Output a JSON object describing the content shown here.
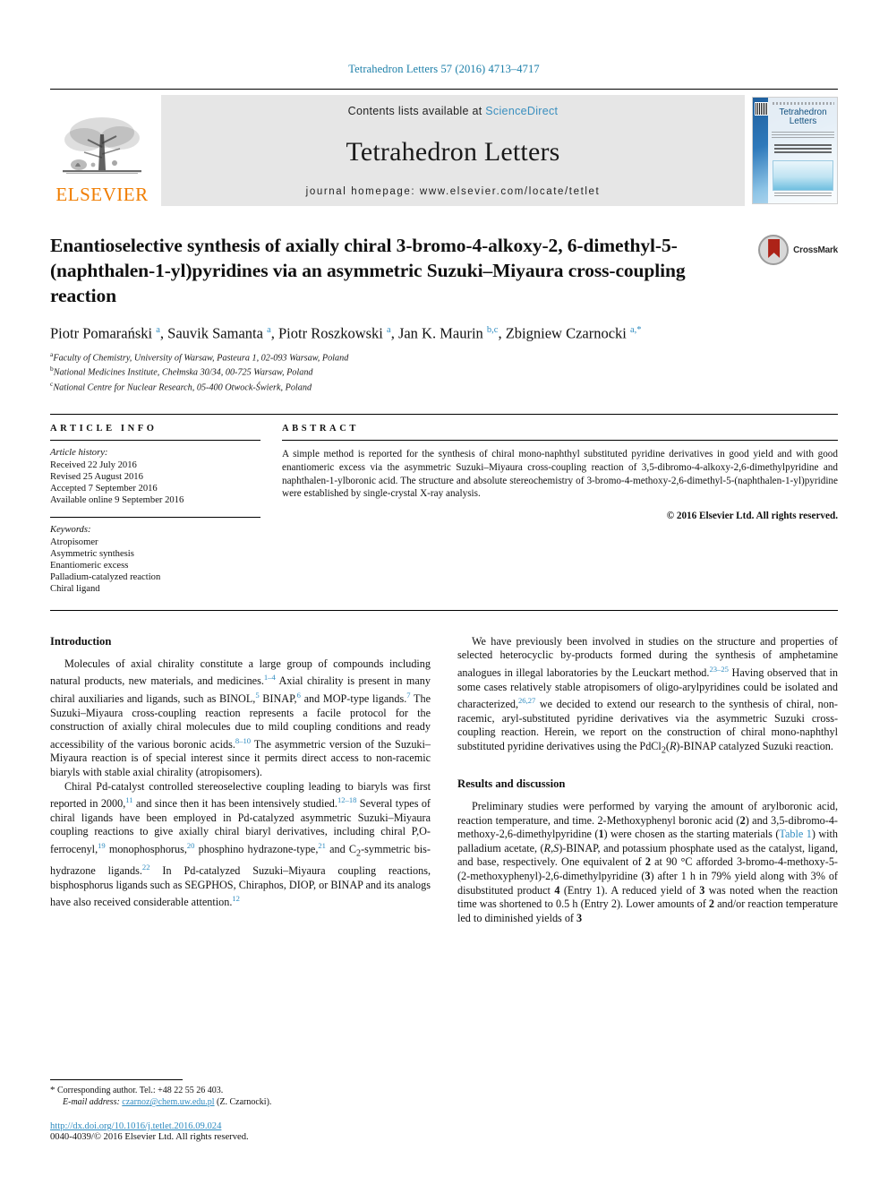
{
  "running_head": "Tetrahedron Letters 57 (2016) 4713–4717",
  "masthead": {
    "contents_prefix": "Contents lists available at ",
    "sciencedirect": "ScienceDirect",
    "journal_title": "Tetrahedron Letters",
    "homepage": "journal homepage: www.elsevier.com/locate/tetlet",
    "publisher_word": "ELSEVIER",
    "cover_title_line1": "Tetrahedron",
    "cover_title_line2": "Letters"
  },
  "article": {
    "title": "Enantioselective synthesis of axially chiral 3-bromo-4-alkoxy-2, 6-dimethyl-5-(naphthalen-1-yl)pyridines via an asymmetric Suzuki–Miyaura cross-coupling reaction",
    "crossmark_label": "CrossMark",
    "authors_html": "Piotr Pomarański <sup>a</sup>, Sauvik Samanta <sup>a</sup>, Piotr Roszkowski <sup>a</sup>, Jan K. Maurin <sup>b,c</sup>, Zbigniew Czarnocki <sup>a,*</sup>",
    "affiliations": [
      "Faculty of Chemistry, University of Warsaw, Pasteura 1, 02-093 Warsaw, Poland",
      "National Medicines Institute, Chełmska 30/34, 00-725 Warsaw, Poland",
      "National Centre for Nuclear Research, 05-400 Otwock-Świerk, Poland"
    ],
    "affiliation_marks": [
      "a",
      "b",
      "c"
    ]
  },
  "article_info": {
    "heading": "ARTICLE INFO",
    "history_heading": "Article history:",
    "history": [
      "Received 22 July 2016",
      "Revised 25 August 2016",
      "Accepted 7 September 2016",
      "Available online 9 September 2016"
    ],
    "keywords_heading": "Keywords:",
    "keywords": [
      "Atropisomer",
      "Asymmetric synthesis",
      "Enantiomeric excess",
      "Palladium-catalyzed reaction",
      "Chiral ligand"
    ]
  },
  "abstract": {
    "heading": "ABSTRACT",
    "text": "A simple method is reported for the synthesis of chiral mono-naphthyl substituted pyridine derivatives in good yield and with good enantiomeric excess via the asymmetric Suzuki–Miyaura cross-coupling reaction of 3,5-dibromo-4-alkoxy-2,6-dimethylpyridine and naphthalen-1-ylboronic acid. The structure and absolute stereochemistry of 3-bromo-4-methoxy-2,6-dimethyl-5-(naphthalen-1-yl)pyridine were established by single-crystal X-ray analysis.",
    "copyright": "© 2016 Elsevier Ltd. All rights reserved."
  },
  "body": {
    "introduction_heading": "Introduction",
    "results_heading": "Results and discussion",
    "intro_p1_html": "Molecules of axial chirality constitute a large group of compounds including natural products, new materials, and medicines.<span class=\"ref\">1–4</span> Axial chirality is present in many chiral auxiliaries and ligands, such as BINOL,<span class=\"ref\">5</span> BINAP,<span class=\"ref\">6</span> and MOP-type ligands.<span class=\"ref\">7</span> The Suzuki–Miyaura cross-coupling reaction represents a facile protocol for the construction of axially chiral molecules due to mild coupling conditions and ready accessibility of the various boronic acids.<span class=\"ref\">8–10</span> The asymmetric version of the Suzuki–Miyaura reaction is of special interest since it permits direct access to non-racemic biaryls with stable axial chirality (atropisomers).",
    "intro_p2_html": "Chiral Pd-catalyst controlled stereoselective coupling leading to biaryls was first reported in 2000,<span class=\"ref\">11</span> and since then it has been intensively studied.<span class=\"ref\">12–18</span> Several types of chiral ligands have been employed in Pd-catalyzed asymmetric Suzuki–Miyaura coupling reactions to give axially chiral biaryl derivatives, including chiral P,O-ferrocenyl,<span class=\"ref\">19</span> monophosphorus,<span class=\"ref\">20</span> phosphino hydrazone-type,<span class=\"ref\">21</span> and C<sub>2</sub>-symmetric bis-hydrazone ligands.<span class=\"ref\">22</span> In Pd-catalyzed Suzuki–Miyaura coupling reactions, bisphosphorus ligands such as SEGPHOS, Chiraphos, DIOP, or BINAP and its analogs have also received considerable attention.<span class=\"ref\">12</span>",
    "right_p1_html": "We have previously been involved in studies on the structure and properties of selected heterocyclic by-products formed during the synthesis of amphetamine analogues in illegal laboratories by the Leuckart method.<span class=\"ref\">23–25</span> Having observed that in some cases relatively stable atropisomers of oligo-arylpyridines could be isolated and characterized,<span class=\"ref\">26,27</span> we decided to extend our research to the synthesis of chiral, non-racemic, aryl-substituted pyridine derivatives via the asymmetric Suzuki cross-coupling reaction. Herein, we report on the construction of chiral mono-naphthyl substituted pyridine derivatives using the PdCl<sub>2</sub>(<i>R</i>)-BINAP catalyzed Suzuki reaction.",
    "right_p2_html": "Preliminary studies were performed by varying the amount of arylboronic acid, reaction temperature, and time. 2-Methoxyphenyl boronic acid (<b>2</b>) and 3,5-dibromo-4-methoxy-2,6-dimethylpyridine (<b>1</b>) were chosen as the starting materials (<span class=\"xlink\">Table 1</span>) with palladium acetate, (<i>R</i>,<i>S</i>)-BINAP, and potassium phosphate used as the catalyst, ligand, and base, respectively. One equivalent of <b>2</b> at 90 °C afforded 3-bromo-4-methoxy-5-(2-methoxyphenyl)-2,6-dimethylpyridine (<b>3</b>) after 1 h in 79% yield along with 3% of disubstituted product <b>4</b> (Entry 1). A reduced yield of <b>3</b> was noted when the reaction time was shortened to 0.5 h (Entry 2). Lower amounts of <b>2</b> and/or reaction temperature led to diminished yields of <b>3</b>"
  },
  "footer": {
    "corresponding_star": "*",
    "corresponding_text": "Corresponding author. Tel.: +48 22 55 26 403.",
    "email_label": "E-mail address:",
    "email": "czarnoz@chem.uw.edu.pl",
    "email_suffix": "(Z. Czarnocki).",
    "doi": "http://dx.doi.org/10.1016/j.tetlet.2016.09.024",
    "issn_line": "0040-4039/© 2016 Elsevier Ltd. All rights reserved."
  },
  "colors": {
    "link": "#2e8bc0",
    "elsevier_orange": "#f07d00",
    "band_gray": "#e6e6e6"
  }
}
